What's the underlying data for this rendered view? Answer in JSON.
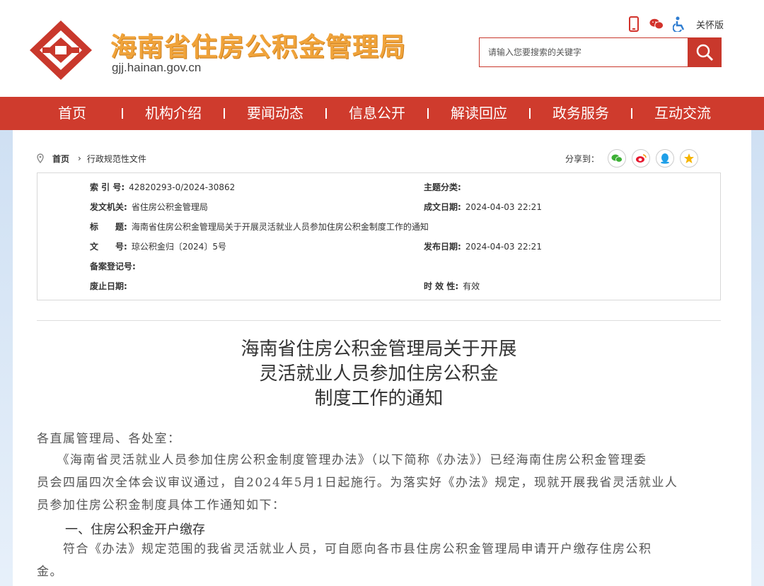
{
  "header": {
    "site_title": "海南省住房公积金管理局",
    "site_domain": "gjj.hainan.gov.cn",
    "care_label": "关怀版",
    "search_placeholder": "请输入您要搜索的关键字",
    "brand_color": "#cf3b2d",
    "title_color": "#f0a33a",
    "tool_icons": [
      "mobile-icon",
      "wechat-icon",
      "accessibility-icon"
    ]
  },
  "nav": {
    "items": [
      "首页",
      "机构介绍",
      "要闻动态",
      "信息公开",
      "解读回应",
      "政务服务",
      "互动交流"
    ]
  },
  "breadcrumb": {
    "home": "首页",
    "current": "行政规范性文件"
  },
  "share": {
    "label": "分享到：",
    "icons": [
      "wechat-icon",
      "weibo-icon",
      "qq-icon",
      "qzone-icon"
    ]
  },
  "meta": {
    "index_label": "索 引 号:",
    "index_value": "42820293-0/2024-30862",
    "topic_label": "主题分类:",
    "topic_value": "",
    "issuer_label": "发文机关:",
    "issuer_value": "省住房公积金管理局",
    "created_label": "成文日期:",
    "created_value": "2024-04-03 22:21",
    "title_label": "标　　题:",
    "title_value": "海南省住房公积金管理局关于开展灵活就业人员参加住房公积金制度工作的通知",
    "docno_label": "文　　号:",
    "docno_value": "琼公积金归〔2024〕5号",
    "published_label": "发布日期:",
    "published_value": "2024-04-03 22:21",
    "record_label": "备案登记号:",
    "record_value": "",
    "abolish_label": "废止日期:",
    "abolish_value": "",
    "validity_label": "时 效 性:",
    "validity_value": "有效"
  },
  "article": {
    "title_line1": "海南省住房公积金管理局关于开展",
    "title_line2": "灵活就业人员参加住房公积金",
    "title_line3": "制度工作的通知",
    "salutation": "各直属管理局、各处室：",
    "p1_line1": "　　《海南省灵活就业人员参加住房公积金制度管理办法》（以下简称《办法》）已经海南住房公积金管理委",
    "p1_line2": "员会四届四次全体会议审议通过，自2024年5月1日起施行。为落实好《办法》规定，现就开展我省灵活就业人",
    "p1_line3": "员参加住房公积金制度具体工作通知如下：",
    "heading1": "一、住房公积金开户缴存",
    "p2_line1": "　　符合《办法》规定范围的我省灵活就业人员，可自愿向各市县住房公积金管理局申请开户缴存住房公积",
    "p2_line2": "金。"
  }
}
